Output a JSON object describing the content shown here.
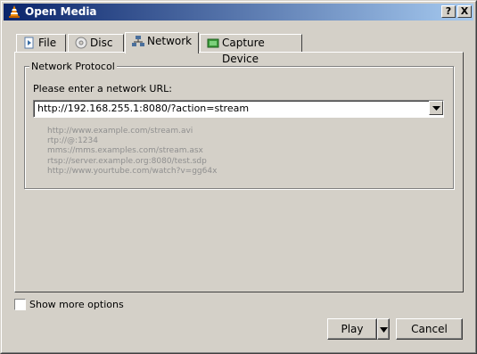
{
  "window": {
    "title": "Open Media",
    "help_button": "?",
    "close_button": "X"
  },
  "tabs": [
    {
      "label": "File",
      "icon": "file-icon"
    },
    {
      "label": "Disc",
      "icon": "disc-icon"
    },
    {
      "label": "Network",
      "icon": "network-icon",
      "active": true
    },
    {
      "label": "Capture Device",
      "icon": "capture-device-icon"
    }
  ],
  "network": {
    "group_title": "Network Protocol",
    "url_label": "Please enter a network URL:",
    "url_value": "http://192.168.255.1:8080/?action=stream",
    "examples": [
      "http://www.example.com/stream.avi",
      "rtp://@:1234",
      "mms://mms.examples.com/stream.asx",
      "rtsp://server.example.org:8080/test.sdp",
      "http://www.yourtube.com/watch?v=gg64x"
    ]
  },
  "options": {
    "show_more_label": "Show more options",
    "show_more_checked": false
  },
  "buttons": {
    "play": "Play",
    "cancel": "Cancel"
  },
  "colors": {
    "title_gradient_start": "#0a246a",
    "title_gradient_end": "#a6caf0",
    "face": "#d4d0c8",
    "example_text": "#8f8f8f"
  }
}
